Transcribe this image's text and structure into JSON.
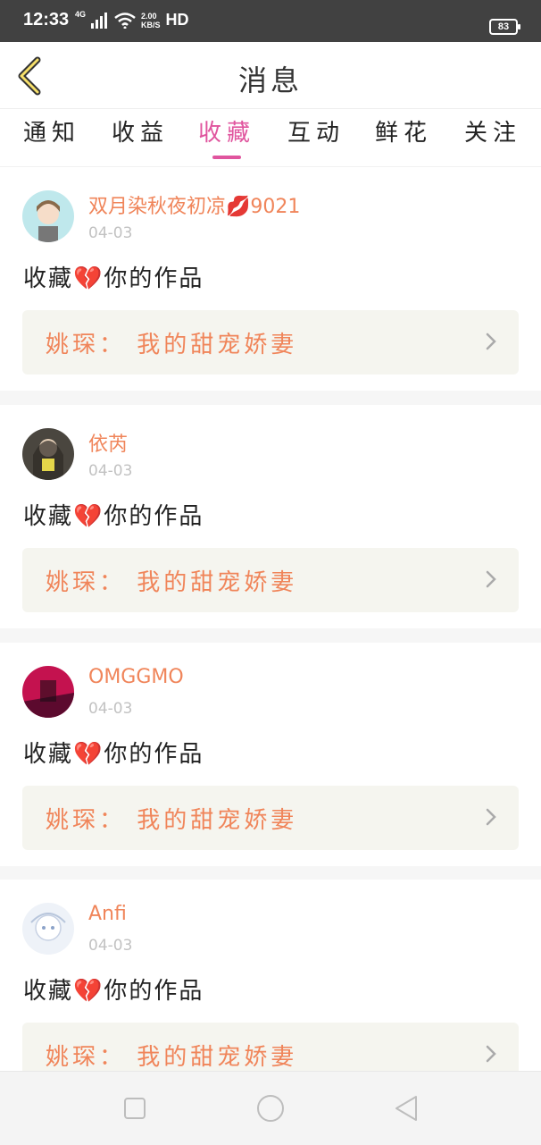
{
  "status_bar": {
    "time": "12:33",
    "network": "4G",
    "speed_value": "2.00",
    "speed_unit": "KB/S",
    "hd": "HD",
    "battery": "83"
  },
  "header": {
    "title": "消息",
    "back_icon": "chevron-left-icon"
  },
  "tabs": [
    {
      "label": "通知",
      "active": false
    },
    {
      "label": "收益",
      "active": false
    },
    {
      "label": "收藏",
      "active": true
    },
    {
      "label": "互动",
      "active": false
    },
    {
      "label": "鲜花",
      "active": false
    },
    {
      "label": "关注",
      "active": false
    }
  ],
  "colors": {
    "accent": "#e0559e",
    "name_orange": "#f0855a",
    "work_box_bg": "#f5f5ef"
  },
  "messages": [
    {
      "username": "双月染秋夜初凉💋9021",
      "date": "04-03",
      "action": "收藏💔你的作品",
      "work": "姚琛： 我的甜宠娇妻"
    },
    {
      "username": "依芮",
      "date": "04-03",
      "action": "收藏💔你的作品",
      "work": "姚琛： 我的甜宠娇妻"
    },
    {
      "username": "OMGGMO",
      "date": "04-03",
      "action": "收藏💔你的作品",
      "work": "姚琛： 我的甜宠娇妻"
    },
    {
      "username": "Anfi",
      "date": "04-03",
      "action": "收藏💔你的作品",
      "work": "姚琛： 我的甜宠娇妻"
    }
  ],
  "nav": {
    "recent_icon": "square-icon",
    "home_icon": "circle-icon",
    "back_icon": "triangle-back-icon"
  }
}
